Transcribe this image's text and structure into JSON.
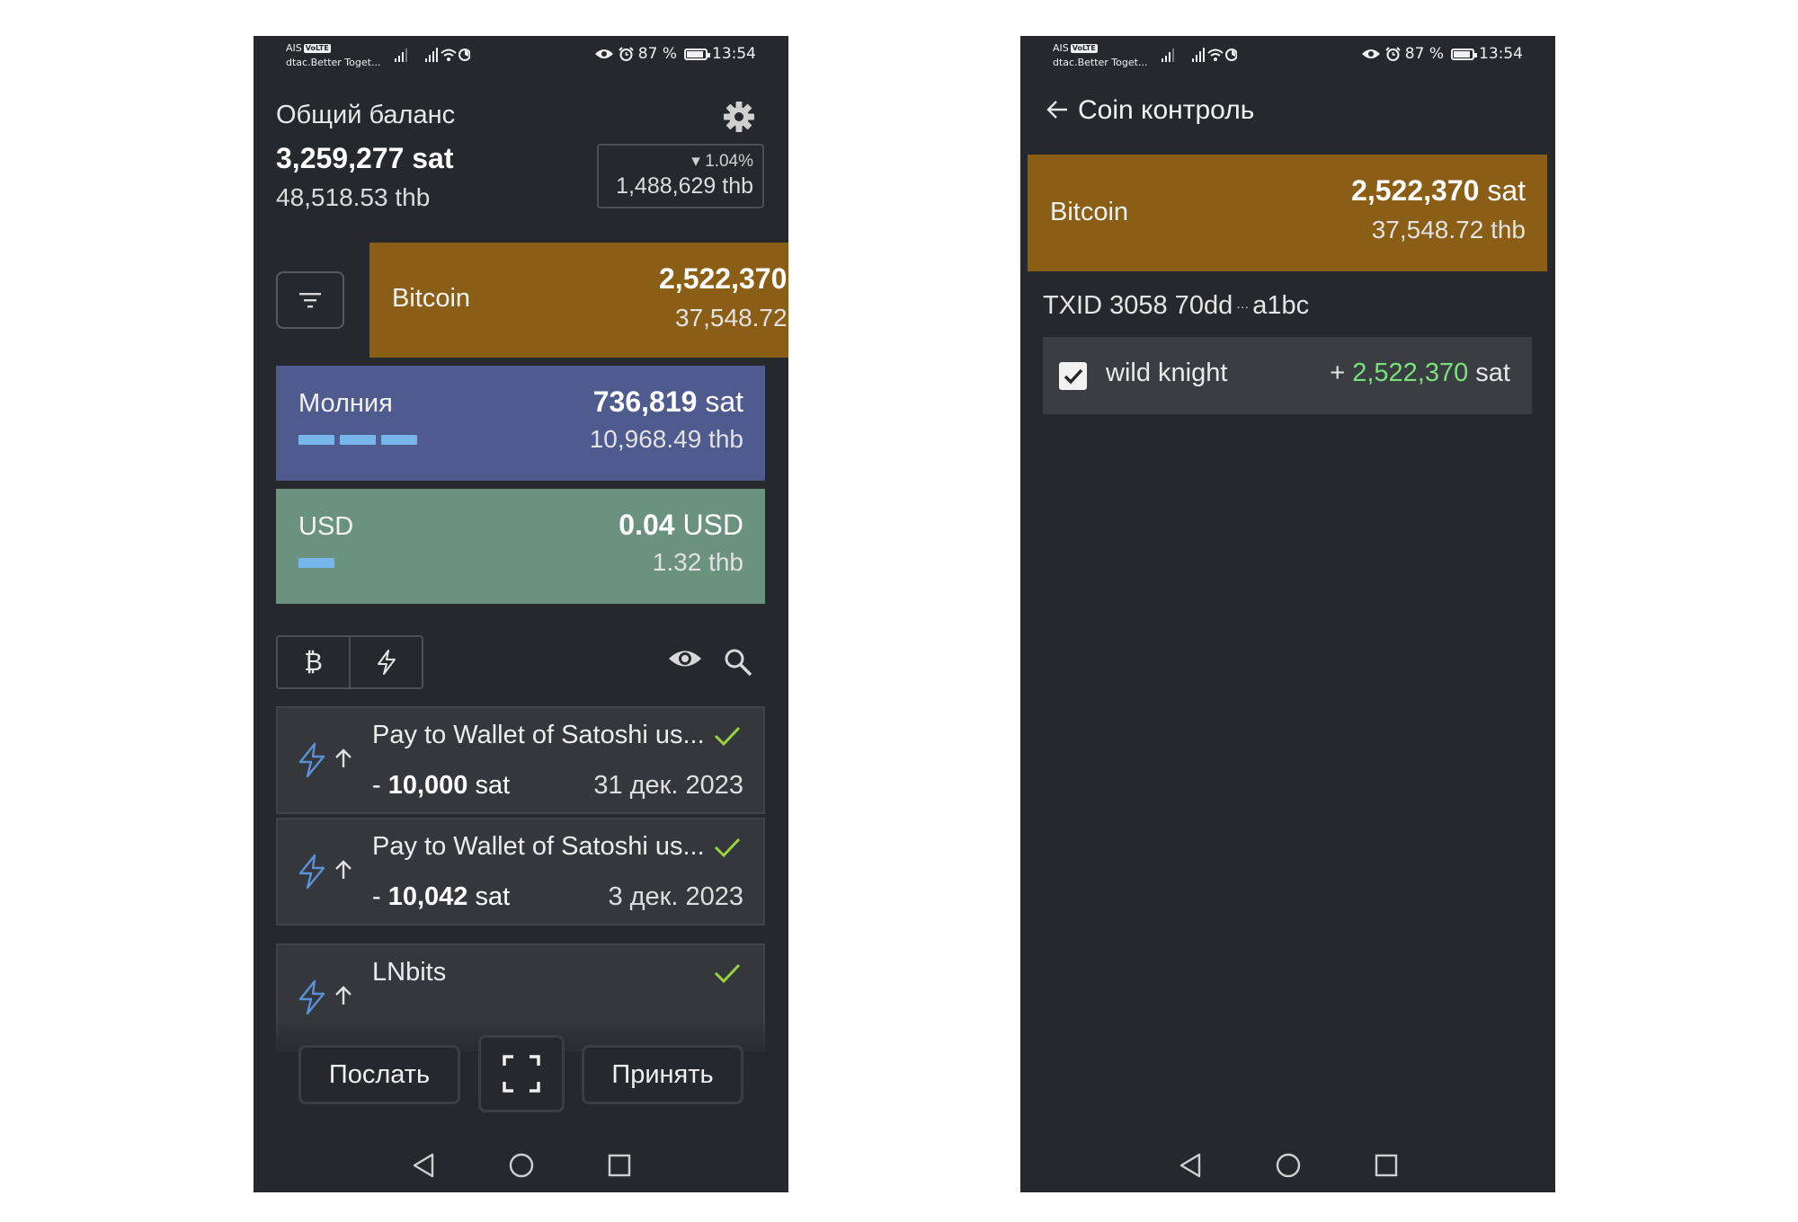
{
  "status_left": {
    "carrier_top": "AIS",
    "volte": "VoLTE",
    "carrier_bottom": "dtac.Better Toget..."
  },
  "status_right": {
    "battery": "87 %",
    "time": "13:54",
    "battery_level_pct": 87
  },
  "left": {
    "balance_title": "Общий баланс",
    "balance_sat": "3,259,277 sat",
    "balance_fiat": "48,518.53 thb",
    "change_pct": "▾ 1.04%",
    "change_value": "1,488,629 thb",
    "wallets": [
      {
        "name": "Bitcoin",
        "amount": "2,522,370",
        "unit": "",
        "fiat": "37,548.72"
      },
      {
        "name": "Молния",
        "amount": "736,819",
        "unit": " sat",
        "fiat": "10,968.49 thb"
      },
      {
        "name": "USD",
        "amount": "0.04",
        "unit": " USD",
        "fiat": "1.32 thb"
      }
    ],
    "transactions": [
      {
        "title": "Pay to Wallet of Satoshi us...",
        "sign": "- ",
        "amount": "10,000",
        "unit": " sat",
        "date": "31 дек. 2023"
      },
      {
        "title": "Pay to Wallet of Satoshi us...",
        "sign": "- ",
        "amount": "10,042",
        "unit": " sat",
        "date": "3 дек. 2023"
      },
      {
        "title": "LNbits",
        "sign": "",
        "amount": "",
        "unit": "",
        "date": ""
      }
    ],
    "buttons": {
      "send": "Послать",
      "receive": "Принять"
    },
    "tab_bitcoin_glyph": "₿"
  },
  "right": {
    "title": "Coin контроль",
    "wallet": {
      "name": "Bitcoin",
      "amount": "2,522,370",
      "unit": " sat",
      "fiat": "37,548.72 thb"
    },
    "txid_label": "TXID 3058 70dd",
    "txid_dots": "···",
    "txid_end": "a1bc",
    "utxo": {
      "label": "wild knight",
      "sign": "+ ",
      "amount": "2,522,370",
      "unit": " sat",
      "checked": true
    }
  },
  "colors": {
    "background": "#25292d",
    "bitcoin": "#8b5e16",
    "lightning": "#4f5b8e",
    "usd": "#6b917f",
    "check": "#9bd43a",
    "positive": "#79e07a",
    "lightning_icon": "#5b8fd6"
  }
}
